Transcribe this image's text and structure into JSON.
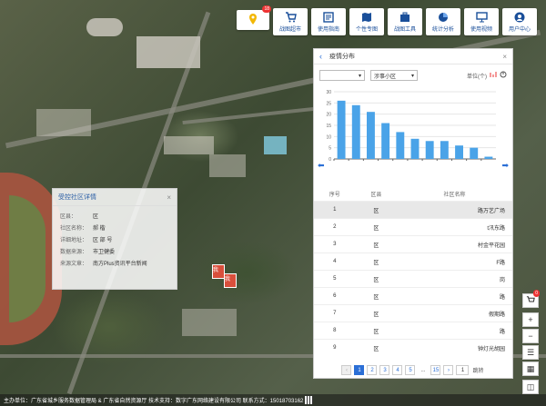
{
  "toolbar": {
    "notification_count": "18",
    "items": [
      {
        "label": "战图超市",
        "icon": "cart-icon"
      },
      {
        "label": "使用指南",
        "icon": "guide-icon"
      },
      {
        "label": "个性专图",
        "icon": "map-book-icon"
      },
      {
        "label": "战图工具",
        "icon": "toolbox-icon"
      },
      {
        "label": "统计分析",
        "icon": "pie-chart-icon"
      },
      {
        "label": "使用视频",
        "icon": "monitor-icon"
      },
      {
        "label": "用户中心",
        "icon": "user-icon"
      }
    ]
  },
  "map_labels": {
    "a": "我",
    "b": "我"
  },
  "detail": {
    "title": "受控社区详情",
    "close": "×",
    "rows": [
      {
        "k": "区县：",
        "v": "区"
      },
      {
        "k": "社区名称：",
        "v": "郝        楷"
      },
      {
        "k": "详细地址：",
        "v": "区        部 号"
      },
      {
        "k": "数据来源：",
        "v": "市卫健委"
      },
      {
        "k": "来源文章：",
        "v": "南方Plus资讯平台新闻"
      }
    ]
  },
  "panel": {
    "title": "疫情分布",
    "back": "‹",
    "close": "×",
    "select1": "",
    "select2": "涉事小区",
    "unit_label": "单位(个)",
    "columns": [
      "序号",
      "区县",
      "社区名称"
    ],
    "rows": [
      {
        "no": "1",
        "district": "区",
        "name": "路万艺广场"
      },
      {
        "no": "2",
        "district": "区",
        "name": "t汛东路"
      },
      {
        "no": "3",
        "district": "区",
        "name": "村金平花园"
      },
      {
        "no": "4",
        "district": "区",
        "name": "F路"
      },
      {
        "no": "5",
        "district": "区",
        "name": "岗"
      },
      {
        "no": "6",
        "district": "区",
        "name": "路"
      },
      {
        "no": "7",
        "district": "区",
        "name": "假期路"
      },
      {
        "no": "8",
        "district": "区",
        "name": "路"
      },
      {
        "no": "9",
        "district": "区",
        "name": "钟灯光胡园"
      }
    ],
    "pager": {
      "prev": "‹",
      "pages": [
        "1",
        "2",
        "3",
        "4",
        "5",
        "...",
        "15"
      ],
      "next": "›",
      "jump_value": "1",
      "jump_label": "跳转"
    }
  },
  "chart_data": {
    "type": "bar",
    "values": [
      26,
      24,
      21,
      16,
      12,
      9,
      8,
      8,
      6,
      5,
      1
    ],
    "ylim": [
      0,
      30
    ],
    "yticks": [
      0,
      5,
      10,
      15,
      20,
      25,
      30
    ],
    "color": "#4aa3e8"
  },
  "side_controls": {
    "cart_count": "0"
  },
  "footer": {
    "text": "主办单位：广东省城乡服务数据管理局 & 广东省自然资源厅    技术支持：数字广东网络建设有限公司    联系方式：15018703162"
  }
}
